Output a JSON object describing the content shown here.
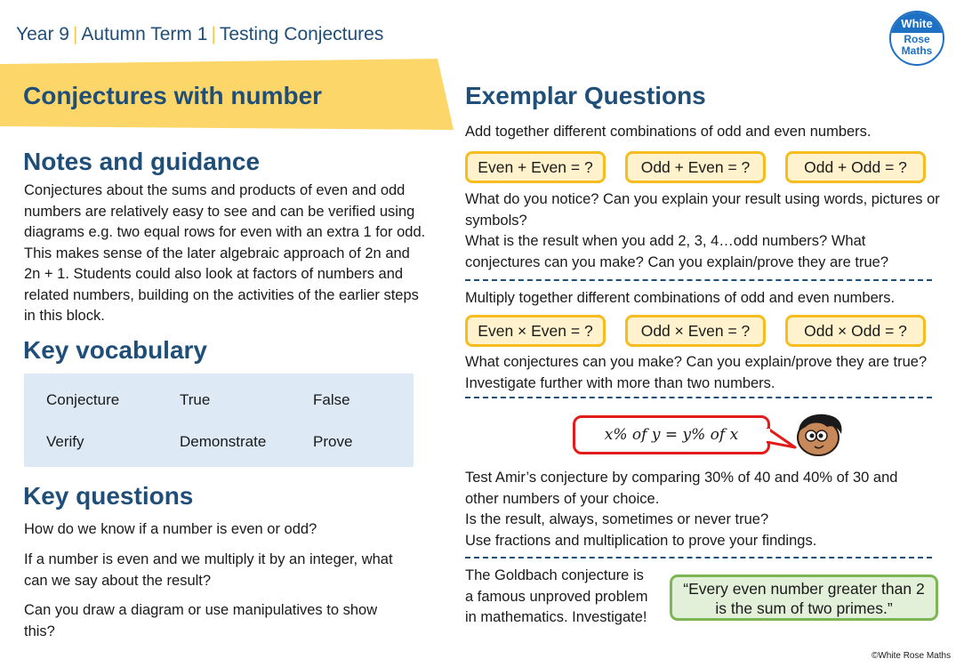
{
  "header": {
    "breadcrumb": [
      "Year 9",
      "Autumn Term 1",
      "Testing Conjectures"
    ],
    "logo": {
      "line1": "White",
      "line2": "Rose",
      "line3": "Maths"
    },
    "banner_title": "Conjectures with number"
  },
  "notes": {
    "title": "Notes and guidance",
    "lines": [
      "Conjectures about the sums and products of even and odd",
      "numbers are relatively easy to see and can be verified using",
      "diagrams e.g. two equal rows for even with an extra 1 for odd.",
      "This makes sense of the later algebraic approach of 2n and",
      "2n + 1. Students could also look at factors of numbers and",
      "related numbers, building on the activities of the earlier steps",
      "in this block."
    ]
  },
  "vocabulary": {
    "title": "Key vocabulary",
    "rows": [
      [
        "Conjecture",
        "True",
        "False"
      ],
      [
        "Verify",
        "Demonstrate",
        "Prove"
      ]
    ]
  },
  "key_questions": {
    "title": "Key questions",
    "items": [
      "How do we know if a number is even or odd?",
      "If a number is even and we multiply it by an integer, what can we say about the result?",
      "Can you draw a diagram or use manipulatives to show this?"
    ]
  },
  "exemplar": {
    "title": "Exemplar Questions",
    "q1": {
      "intro": "Add together different combinations of odd and even numbers.",
      "pills": [
        "Even + Even = ?",
        "Odd + Even = ?",
        "Odd + Odd = ?"
      ],
      "follow_lines": [
        "What do you notice? Can you explain your result using words, pictures or",
        "symbols?",
        "What is the result when you add 2, 3, 4…odd numbers? What",
        "conjectures can you make? Can you explain/prove they are true?"
      ]
    },
    "q2": {
      "intro": "Multiply together different combinations of odd and even numbers.",
      "pills": [
        "Even × Even = ?",
        "Odd × Even = ?",
        "Odd × Odd = ?"
      ],
      "follow_lines": [
        "What conjectures can you make? Can you explain/prove they are true?",
        "Investigate further with more than two numbers."
      ]
    },
    "q3": {
      "speech": "x% of y = y% of x",
      "lines": [
        "Test Amir’s conjecture by comparing 30% of 40 and 40% of 30 and",
        "other numbers of your choice.",
        "Is the result, always, sometimes or never true?",
        "Use fractions and multiplication to prove your findings."
      ]
    },
    "q4": {
      "lines": [
        "The Goldbach conjecture is",
        "a famous unproved problem",
        "in mathematics. Investigate!"
      ],
      "quote_lines": [
        "“Every even number greater than 2",
        "is the sum of two primes.”"
      ]
    }
  },
  "footer": {
    "copyright": "©White Rose Maths"
  },
  "colors": {
    "heading": "#1f4e79",
    "banner": "#fcd669",
    "pill_fill": "#fff2cc",
    "pill_border": "#f5bd1f",
    "vocab_bg": "#dde9f5",
    "speech_border": "#e31b1b",
    "quote_fill": "#e2efd9",
    "quote_border": "#7cb554",
    "logo_blue": "#1d70c4"
  }
}
